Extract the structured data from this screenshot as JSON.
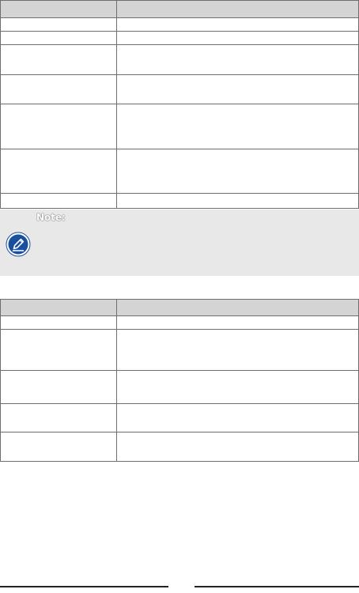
{
  "table1": {
    "header": [
      "",
      ""
    ],
    "rows": [
      [
        "",
        ""
      ],
      [
        "",
        ""
      ],
      [
        "",
        ""
      ],
      [
        "",
        ""
      ],
      [
        "",
        ""
      ],
      [
        "",
        ""
      ],
      [
        "",
        ""
      ]
    ]
  },
  "note": {
    "title": "Note:",
    "icon": "pencil-icon",
    "text": ""
  },
  "table2": {
    "header": [
      "",
      ""
    ],
    "rows": [
      [
        "",
        ""
      ],
      [
        "",
        ""
      ],
      [
        "",
        ""
      ],
      [
        "",
        ""
      ],
      [
        "",
        ""
      ]
    ]
  },
  "colors": {
    "header_bg": "#d4d4d4",
    "note_bg": "#e8e8e8",
    "icon_blue": "#1a4fa0",
    "border": "#6e6e6e"
  }
}
